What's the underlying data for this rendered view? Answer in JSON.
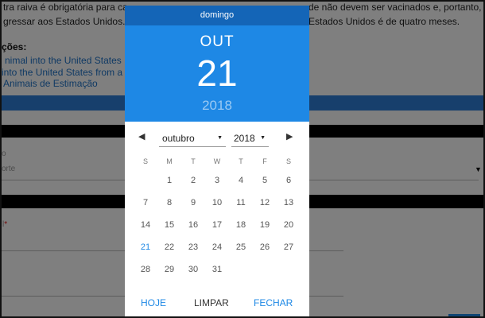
{
  "background": {
    "line1_left": "tra raiva é obrigatória para ca",
    "line2_left": "gressar aos Estados Unidos. E",
    "line1_right": "de não devem ser vacinados e, portanto,",
    "line2_right": "Estados Unidos é de quatro meses.",
    "section_heading": "ções:",
    "link1": "nimal into the United States",
    "link2": " into the United States from a",
    "link3": "Animais de Estimação",
    "field1_label": "o",
    "field1_placeholder": "orte",
    "field2_label": "l",
    "required_mark": "*",
    "colors": {
      "accent": "#2f7fd8",
      "bar": "#000000"
    }
  },
  "datepicker": {
    "weekday": "domingo",
    "month_abbr": "OUT",
    "day": "21",
    "year": "2018",
    "nav": {
      "prev_icon": "triangle-left-icon",
      "next_icon": "triangle-right-icon",
      "prev": "◀",
      "next": "▶"
    },
    "month_select": {
      "value": "outubro",
      "caret": "▼"
    },
    "year_select": {
      "value": "2018",
      "caret": "▼"
    },
    "day_headers": [
      "S",
      "M",
      "T",
      "W",
      "T",
      "F",
      "S"
    ],
    "weeks": [
      [
        "",
        "1",
        "2",
        "3",
        "4",
        "5",
        "6"
      ],
      [
        "7",
        "8",
        "9",
        "10",
        "11",
        "12",
        "13"
      ],
      [
        "14",
        "15",
        "16",
        "17",
        "18",
        "19",
        "20"
      ],
      [
        "21",
        "22",
        "23",
        "24",
        "25",
        "26",
        "27"
      ],
      [
        "28",
        "29",
        "30",
        "31",
        "",
        "",
        ""
      ]
    ],
    "selected_day": "21",
    "buttons": {
      "today": "HOJE",
      "clear": "LIMPAR",
      "close": "FECHAR"
    },
    "colors": {
      "header": "#1e88e5",
      "weekday_bar": "#1465b7",
      "accent": "#1e88e5"
    }
  }
}
